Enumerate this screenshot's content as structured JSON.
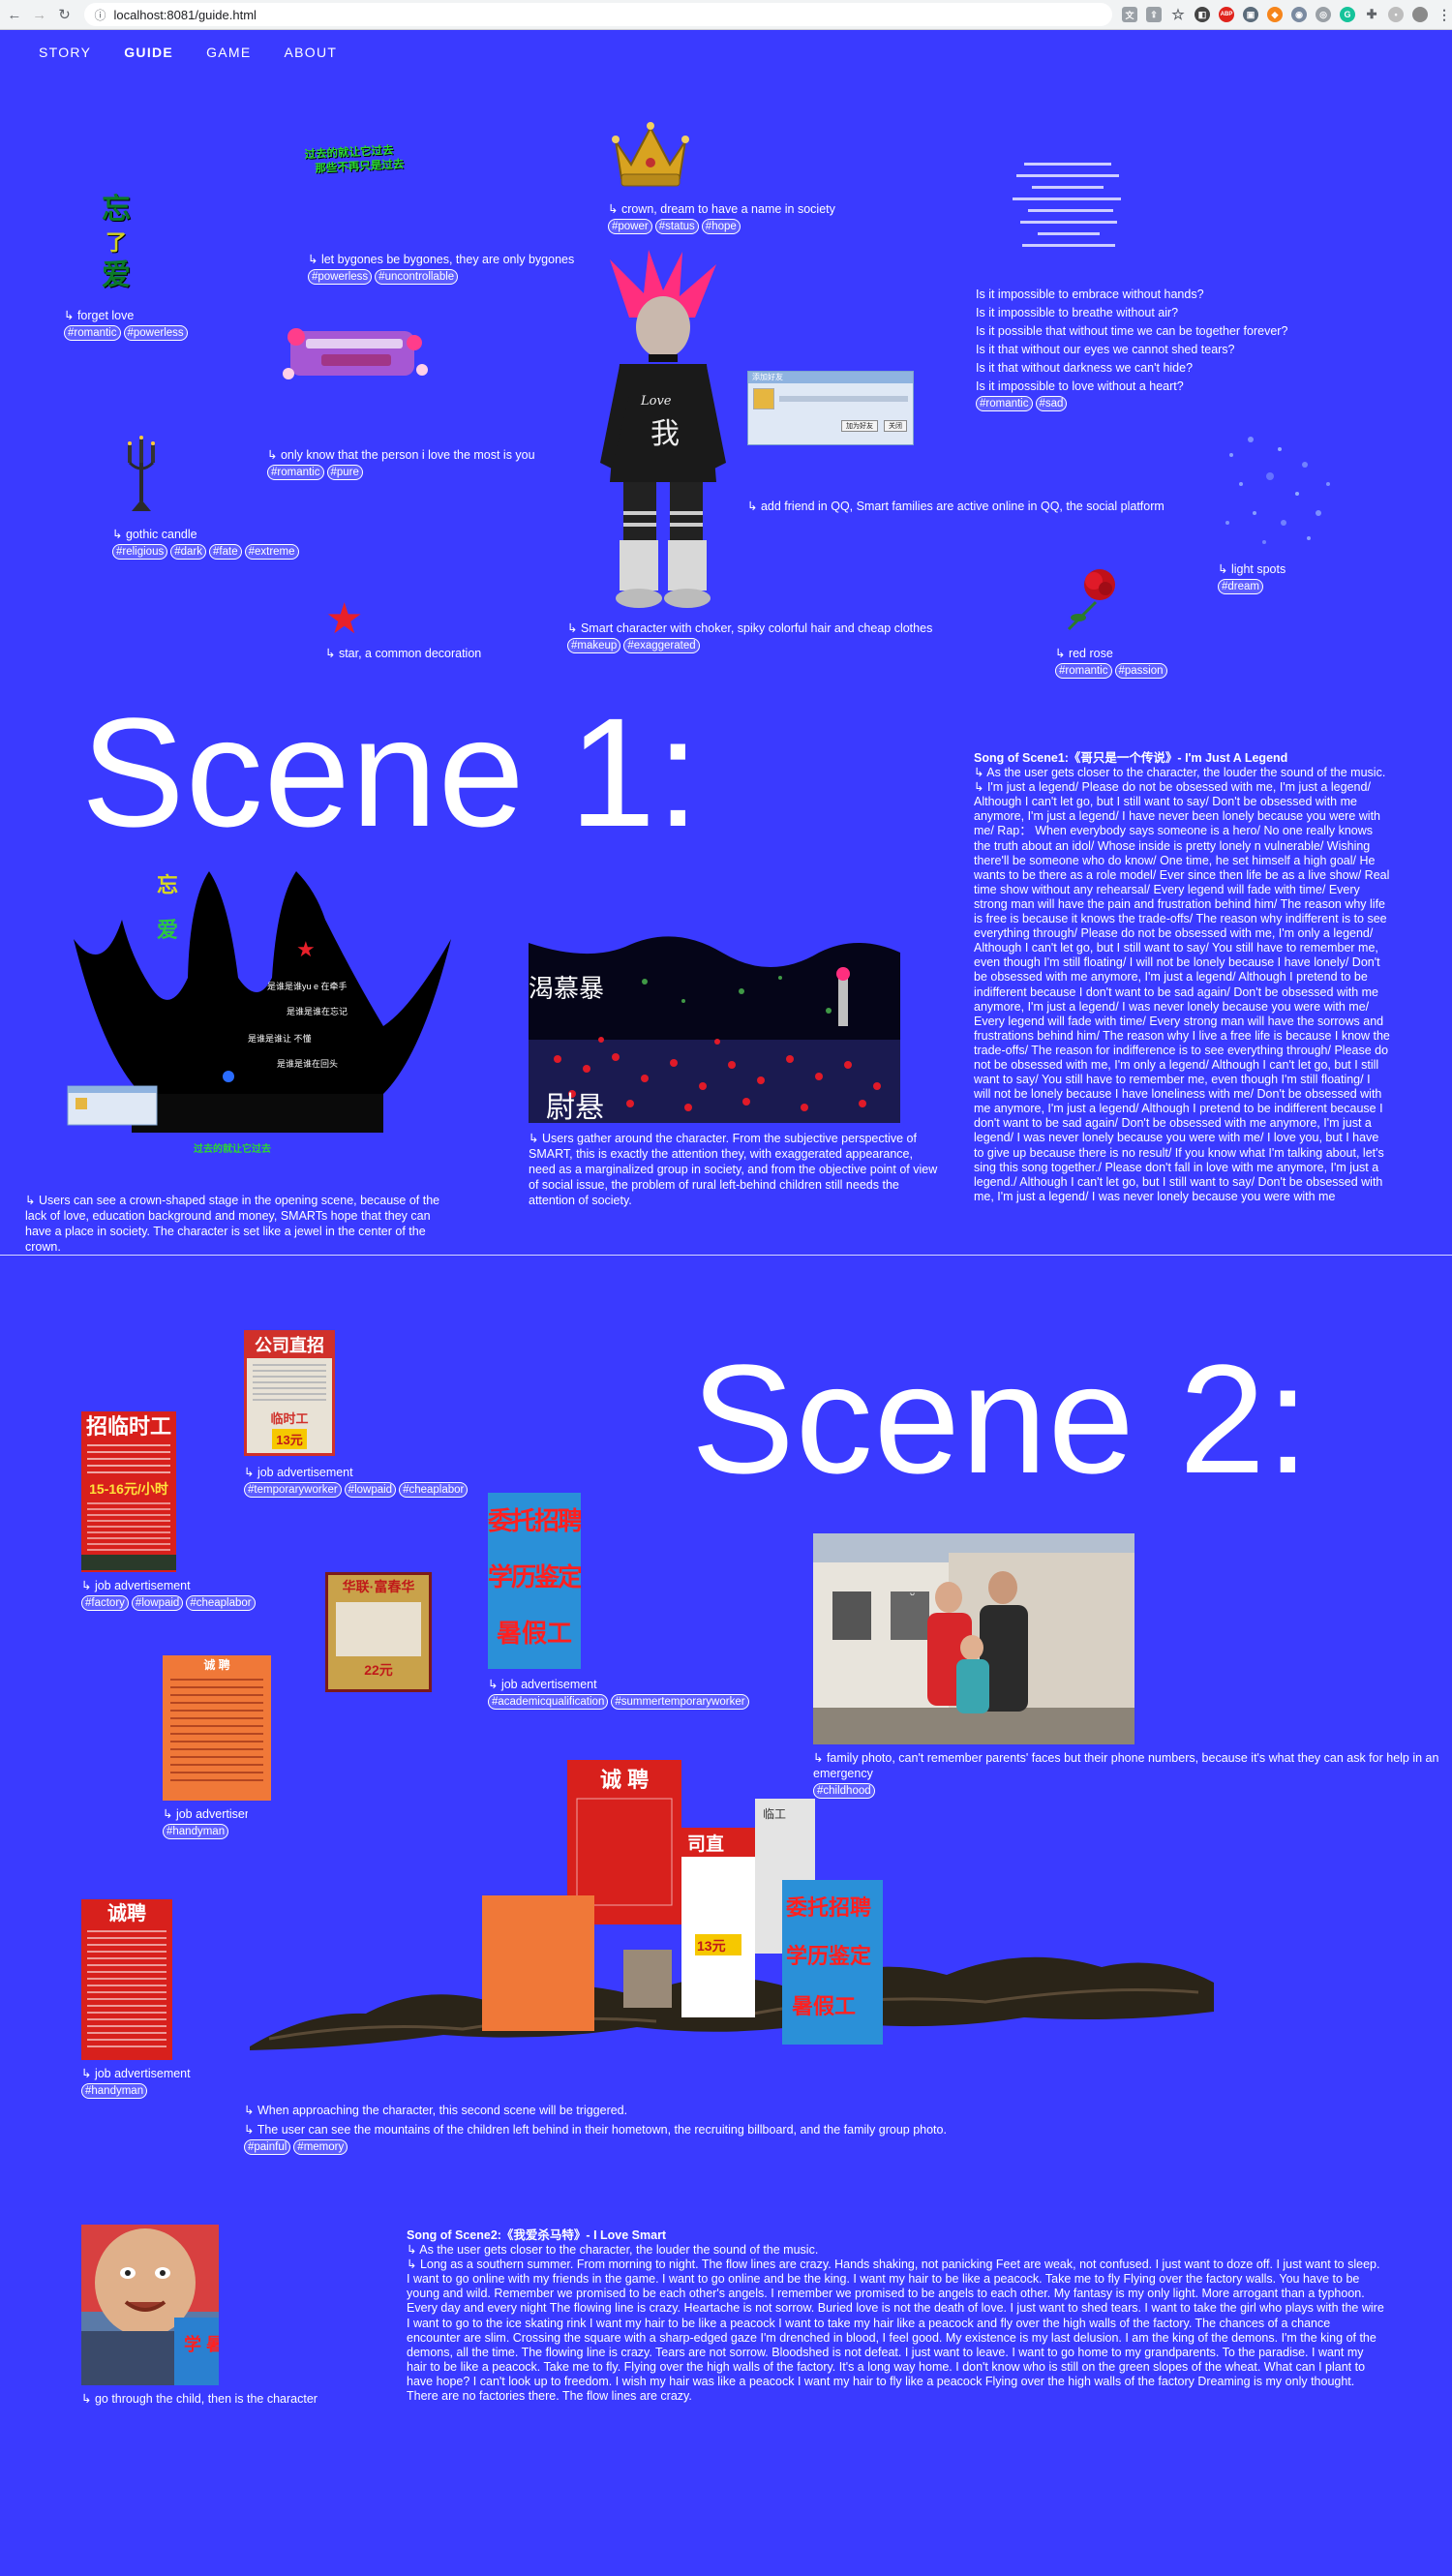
{
  "browser": {
    "url": "localhost:8081/guide.html",
    "ext_abp": "ABP"
  },
  "nav": {
    "items": [
      {
        "label": "STORY",
        "active": false
      },
      {
        "label": "GUIDE",
        "active": true
      },
      {
        "label": "GAME",
        "active": false
      },
      {
        "label": "ABOUT",
        "active": false
      }
    ]
  },
  "items": {
    "forget_love": {
      "caption": "↳ forget love",
      "tags": [
        "#romantic",
        "#powerless"
      ],
      "art_text": [
        "忘",
        "了",
        "爱"
      ]
    },
    "bygones": {
      "caption": "↳ let bygones be bygones, they are only bygones",
      "tags": [
        "#powerless",
        "#uncontrollable"
      ],
      "art_text": [
        "过去的就让它过去",
        "那些不再只是过去"
      ]
    },
    "crown": {
      "caption": "↳ crown, dream to have a name in society",
      "tags": [
        "#power",
        "#status",
        "#hope"
      ]
    },
    "poem": {
      "lines": [
        "Is it impossible to embrace without hands?",
        "Is it impossible to breathe without air?",
        "Is it possible that without time we can be together forever?",
        "Is it that without our eyes we cannot shed tears?",
        "Is it that without darkness we can't hide?",
        "Is it impossible to love without a heart?"
      ],
      "tags": [
        "#romantic",
        "#sad"
      ]
    },
    "love_text": {
      "caption": "↳ only know that the person i love the most is you",
      "tags": [
        "#romantic",
        "#pure"
      ]
    },
    "candle": {
      "caption": "↳ gothic candle",
      "tags": [
        "#religious",
        "#dark",
        "#fate",
        "#extreme"
      ]
    },
    "character": {
      "caption": "↳ Smart character with choker, spiky colorful hair and cheap clothes",
      "tags": [
        "#makeup",
        "#exaggerated"
      ],
      "shirt_text": "Love",
      "shirt_glyph": "我"
    },
    "qq": {
      "caption": "↳ add friend in QQ, Smart families are active online in QQ, the social platform",
      "title": "添加好友",
      "btn1": "加为好友",
      "btn2": "关闭"
    },
    "light_spots": {
      "caption": "↳ light spots",
      "tags": [
        "#dream"
      ]
    },
    "rose": {
      "caption": "↳ red rose",
      "tags": [
        "#romantic",
        "#passion"
      ]
    },
    "star": {
      "caption": "↳ star, a common decoration"
    }
  },
  "scene1": {
    "title": "Scene 1:",
    "stage_caption": "↳ Users can see a crown-shaped stage in the opening scene, because of the lack of love, education background and money, SMARTs hope that they can have a place in society. The character is set like a jewel in the center of the crown.",
    "crowd_caption": "↳ Users gather around the character. From the subjective perspective of SMART, this is exactly the attention they, with exaggerated appearance, need as a marginalized group in society, and from the objective point of view of social issue, the problem of rural left-behind children still needs the attention of society.",
    "song_title": "Song of Scene1:《哥只是一个传说》- I'm Just A Legend",
    "song_intro": "↳ As the user gets closer to the character, the louder the sound of the music.",
    "song_lyrics": "↳ I'm just a legend/ Please do not be obsessed with me, I'm just a legend/ Although I can't let go, but I still want to say/ Don't be obsessed with me anymore, I'm just a legend/ I have never been lonely because you were with me/ Rap： When everybody says someone is a hero/ No one really knows the truth about an idol/ Whose inside is pretty lonely n vulnerable/ Wishing there'll be someone who do know/ One time, he set himself a high goal/ He wants to be there as a role model/ Ever since then life be as a live show/ Real time show without any rehearsal/ Every legend will fade with time/ Every strong man will have the pain and frustration behind him/ The reason why life is free is because it knows the trade-offs/ The reason why indifferent is to see everything through/ Please do not be obsessed with me, I'm only a legend/ Although I can't let go, but I still want to say/ You still have to remember me, even though I'm still floating/ I will not be lonely because I have lonely/ Don't be obsessed with me anymore, I'm just a legend/ Although I pretend to be indifferent because I don't want to be sad again/ Don't be obsessed with me anymore, I'm just a legend/ I was never lonely because you were with me/ Every legend will fade with time/ Every strong man will have the sorrows and frustrations behind him/ The reason why I live a free life is because I know the trade-offs/ The reason for indifference is to see everything through/ Please do not be obsessed with me, I'm only a legend/ Although I can't let go, but I still want to say/ You still have to remember me, even though I'm still floating/ I will not be lonely because I have loneliness with me/ Don't be obsessed with me anymore, I'm just a legend/ Although I pretend to be indifferent because I don't want to be sad again/ Don't be obsessed with me anymore, I'm just a legend/ I was never lonely because you were with me/ I love you, but I have to give up because there is no result/ If you know what I'm talking about, let's sing this song together./ Please don't fall in love with me anymore, I'm just a legend./ Although I can't let go, but I still want to say/ Don't be obsessed with me, I'm just a legend/ I was never lonely because you were with me",
    "stage_text": [
      "是谁是谁yu e 在牵手",
      "是谁是谁在忘记",
      "是谁是谁让 不懂",
      "是谁是谁在回头"
    ],
    "crowd_text": [
      "渴慕暴",
      "尉悬"
    ]
  },
  "scene2": {
    "title": "Scene 2:",
    "job1": {
      "caption": "↳ job advertisement",
      "tags": [
        "#temporaryworker",
        "#lowpaid",
        "#cheaplabor"
      ],
      "poster_title": "公司直招",
      "poster_badge": "临时工",
      "poster_price": "13元"
    },
    "job2": {
      "caption": "↳ job advertisement",
      "tags": [
        "#factory",
        "#lowpaid",
        "#cheaplabor"
      ],
      "poster_title": "招临时工",
      "poster_price": "15-16元/小时"
    },
    "job3": {
      "caption": "↳ job advertisement",
      "tags": [
        "#academicqualification",
        "#summertemporaryworker"
      ],
      "poster_lines": [
        "委托招聘",
        "学历鉴定",
        "暑假工"
      ]
    },
    "job4": {
      "caption": "↳ job advertisement",
      "tags": [
        "#handyman"
      ],
      "poster_title": "诚 聘"
    },
    "job5": {
      "caption": "↳ job advertisement",
      "tags": [
        "#handyman"
      ],
      "poster_title": "诚聘"
    },
    "job6": {
      "poster_title": "华联·富春华",
      "poster_price": "22元"
    },
    "family": {
      "caption": "↳ family photo, can't remember parents' faces but their phone numbers, because it's what they can ask for help in an emergency",
      "tags": [
        "#childhood"
      ]
    },
    "mountain_caption1": "↳ When approaching the character, this second scene will be triggered.",
    "mountain_caption2": "↳ The user can see the mountains of the children left behind in their hometown, the recruiting billboard, and the family group photo.",
    "mountain_tags": [
      "#painful",
      "#memory"
    ],
    "mountain_posters": [
      "诚 聘",
      "司直",
      "委托招聘",
      "学历鉴定",
      "暑假工",
      "13元",
      "临工"
    ],
    "child_caption": "↳ go through the child, then is the character",
    "child_poster": "学 暑",
    "song_title": "Song of Scene2:《我爱杀马特》- I Love Smart",
    "song_intro": "↳ As the user gets closer to the character, the louder the sound of the music.",
    "song_lyrics": "↳ Long as a southern summer. From morning to night. The flow lines are crazy. Hands shaking, not panicking Feet are weak, not confused. I just want to doze off. I just want to sleep. I want to go online with my friends in the game. I want to go online and be the king. I want my hair to be like a peacock. Take me to fly Flying over the factory walls. You have to be young and wild. Remember we promised to be each other's angels. I remember we promised to be angels to each other. My fantasy is my only light. More arrogant than a typhoon. Every day and every night The flowing line is crazy. Heartache is not sorrow. Buried love is not the death of love. I just want to shed tears. I want to take the girl who plays with the wire I want to go to the ice skating rink I want my hair to be like a peacock I want to take my hair like a peacock and fly over the high walls of the factory. The chances of a chance encounter are slim. Crossing the square with a sharp-edged gaze I'm drenched in blood, I feel good. My existence is my last delusion. I am the king of the demons. I'm the king of the demons, all the time. The flowing line is crazy. Tears are not sorrow. Bloodshed is not defeat. I just want to leave. I want to go home to my grandparents. To the paradise. I want my hair to be like a peacock. Take me to fly. Flying over the high walls of the factory. It's a long way home. I don't know who is still on the green slopes of the wheat. What can I plant to have hope? I can't look up to freedom. I wish my hair was like a peacock I want my hair to fly like a peacock Flying over the high walls of the factory Dreaming is my only thought. There are no factories there. The flow lines are crazy."
  },
  "colors": {
    "background": "#3a3aff",
    "text": "#ffffff",
    "accent_red": "#e8202a",
    "accent_pink": "#ff3d8b"
  }
}
